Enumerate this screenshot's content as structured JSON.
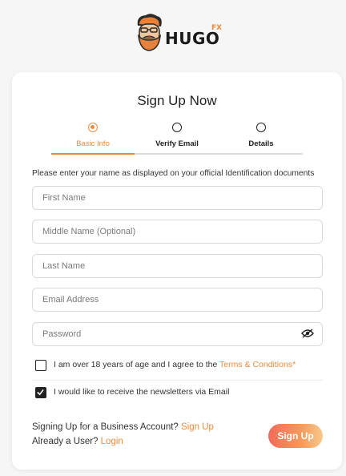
{
  "brand": {
    "name": "HUGO",
    "suffix": "FX"
  },
  "title": "Sign Up Now",
  "steps": [
    {
      "label": "Basic Info",
      "active": true
    },
    {
      "label": "Verify Email",
      "active": false
    },
    {
      "label": "Details",
      "active": false
    }
  ],
  "instruction": "Please enter your name as displayed on your official Identification documents",
  "fields": {
    "first_name": {
      "placeholder": "First Name",
      "value": ""
    },
    "middle_name": {
      "placeholder": "Middle Name (Optional)",
      "value": ""
    },
    "last_name": {
      "placeholder": "Last Name",
      "value": ""
    },
    "email": {
      "placeholder": "Email Address",
      "value": ""
    },
    "password": {
      "placeholder": "Password",
      "value": ""
    }
  },
  "terms": {
    "text": "I am over 18 years of age and I agree to the ",
    "link": "Terms & Conditions*",
    "checked": false
  },
  "newsletter": {
    "text": "I would like to receive the newsletters via Email",
    "checked": true
  },
  "business": {
    "text": "Signing Up for a Business Account? ",
    "link": "Sign Up"
  },
  "existing": {
    "text": "Already a User? ",
    "link": "Login"
  },
  "submit_label": "Sign Up",
  "colors": {
    "accent": "#f08a3a",
    "button_start": "#f46b5a",
    "button_end": "#f7c98a"
  },
  "icons": {
    "logo": "hugo-face-logo",
    "password_toggle": "eye-slash-icon",
    "check": "checkmark-icon"
  }
}
